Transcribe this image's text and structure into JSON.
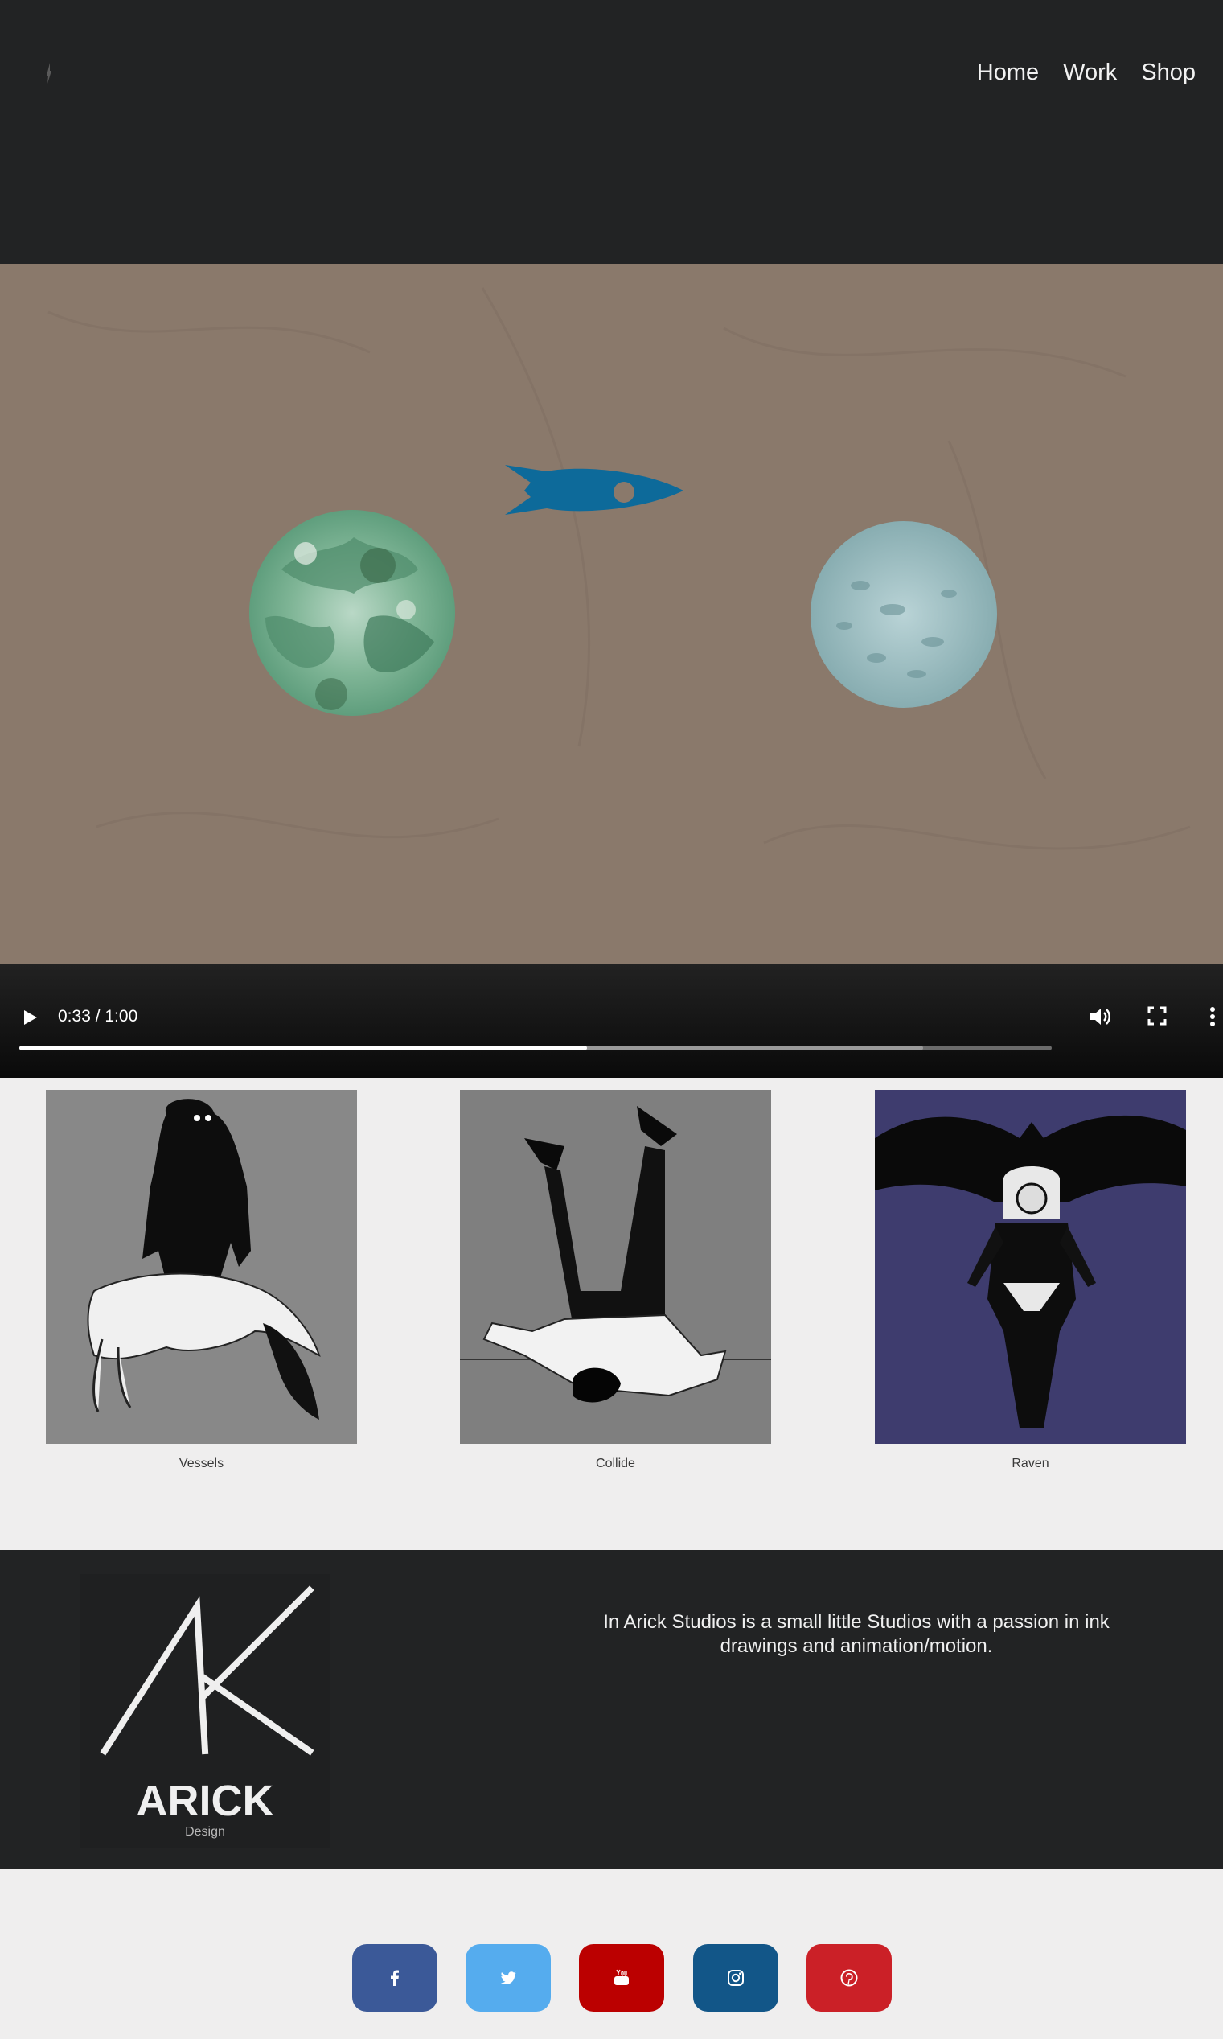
{
  "header": {
    "nav": [
      {
        "label": "Home"
      },
      {
        "label": "Work"
      },
      {
        "label": "Shop"
      }
    ]
  },
  "video": {
    "current_time": "0:33",
    "duration": "1:00",
    "time_label": "0:33 / 1:00",
    "progress_fraction": 0.55,
    "buffered_fraction": 0.875,
    "colors": {
      "backdrop": "#8a796b",
      "rocket": "#0d6a9a"
    }
  },
  "gallery": {
    "items": [
      {
        "caption": "Vessels"
      },
      {
        "caption": "Collide"
      },
      {
        "caption": "Raven"
      }
    ]
  },
  "footer": {
    "brand_name": "ARICK",
    "brand_sub": "Design",
    "about": "In Arick Studios is a small little Studios with a passion in ink drawings and animation/motion."
  },
  "social": [
    {
      "icon": "facebook-icon",
      "color": "#3b5998"
    },
    {
      "icon": "twitter-icon",
      "color": "#55acee"
    },
    {
      "icon": "youtube-icon",
      "color": "#bb0000"
    },
    {
      "icon": "instagram-icon",
      "color": "#125688"
    },
    {
      "icon": "pinterest-icon",
      "color": "#cb2027"
    }
  ]
}
